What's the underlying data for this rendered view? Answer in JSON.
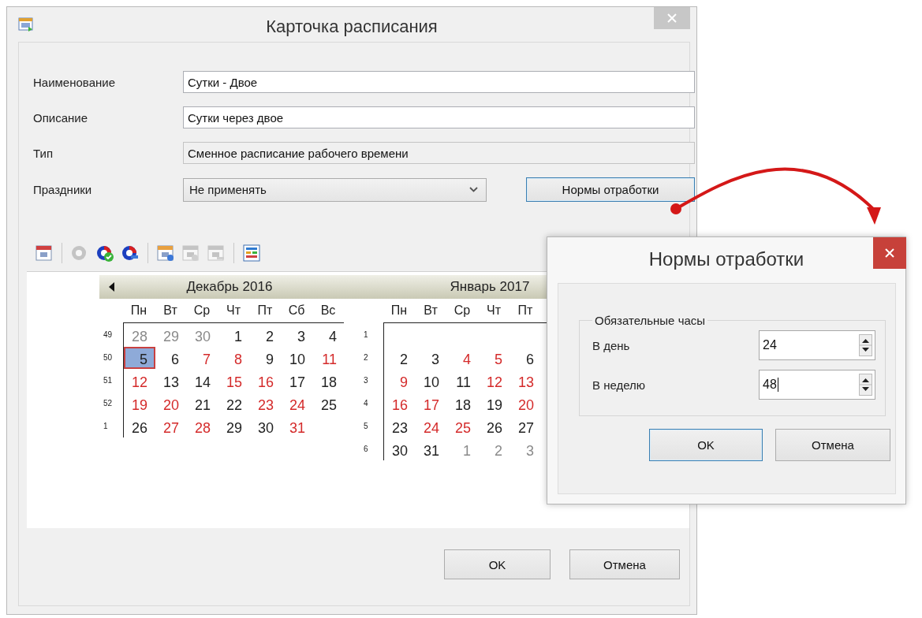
{
  "main_dialog": {
    "title": "Карточка расписания",
    "fields": [
      {
        "label": "Наименование",
        "value": "Сутки - Двое",
        "readonly": false
      },
      {
        "label": "Описание",
        "value": "Сутки через двое",
        "readonly": false
      },
      {
        "label": "Тип",
        "value": "Сменное расписание рабочего времени",
        "readonly": true
      }
    ],
    "holidays": {
      "label": "Праздники",
      "value": "Не применять"
    },
    "norms_button": {
      "label": "Нормы отработки",
      "default": true
    },
    "toolbar": [
      {
        "kind": "calendar",
        "disabled": false
      },
      {
        "kind": "separator"
      },
      {
        "kind": "refresh",
        "disabled": true
      },
      {
        "kind": "refresh-check",
        "disabled": false
      },
      {
        "kind": "refresh-minus",
        "disabled": false
      },
      {
        "kind": "separator"
      },
      {
        "kind": "day-edit",
        "disabled": false
      },
      {
        "kind": "day-check",
        "disabled": true
      },
      {
        "kind": "day-minus",
        "disabled": true
      },
      {
        "kind": "separator"
      },
      {
        "kind": "grid",
        "disabled": false
      }
    ],
    "calendar": {
      "months": [
        {
          "title": "Декабрь 2016",
          "has_prev": true,
          "weekdays": [
            "Пн",
            "Вт",
            "Ср",
            "Чт",
            "Пт",
            "Сб",
            "Вс"
          ],
          "weeks": [
            {
              "number": "49",
              "days": [
                {
                  "text": "28",
                  "kind": "other",
                  "selected": false
                },
                {
                  "text": "29",
                  "kind": "other",
                  "selected": false
                },
                {
                  "text": "30",
                  "kind": "other",
                  "selected": false
                },
                {
                  "text": "1",
                  "kind": "work",
                  "selected": false
                },
                {
                  "text": "2",
                  "kind": "work",
                  "selected": false
                },
                {
                  "text": "3",
                  "kind": "work",
                  "selected": false
                },
                {
                  "text": "4",
                  "kind": "work",
                  "selected": false
                }
              ]
            },
            {
              "number": "50",
              "days": [
                {
                  "text": "5",
                  "kind": "work",
                  "selected": true
                },
                {
                  "text": "6",
                  "kind": "work",
                  "selected": false
                },
                {
                  "text": "7",
                  "kind": "off",
                  "selected": false
                },
                {
                  "text": "8",
                  "kind": "off",
                  "selected": false
                },
                {
                  "text": "9",
                  "kind": "work",
                  "selected": false
                },
                {
                  "text": "10",
                  "kind": "work",
                  "selected": false
                },
                {
                  "text": "11",
                  "kind": "off",
                  "selected": false
                }
              ]
            },
            {
              "number": "51",
              "days": [
                {
                  "text": "12",
                  "kind": "off",
                  "selected": false
                },
                {
                  "text": "13",
                  "kind": "work",
                  "selected": false
                },
                {
                  "text": "14",
                  "kind": "work",
                  "selected": false
                },
                {
                  "text": "15",
                  "kind": "off",
                  "selected": false
                },
                {
                  "text": "16",
                  "kind": "off",
                  "selected": false
                },
                {
                  "text": "17",
                  "kind": "work",
                  "selected": false
                },
                {
                  "text": "18",
                  "kind": "work",
                  "selected": false
                }
              ]
            },
            {
              "number": "52",
              "days": [
                {
                  "text": "19",
                  "kind": "off",
                  "selected": false
                },
                {
                  "text": "20",
                  "kind": "off",
                  "selected": false
                },
                {
                  "text": "21",
                  "kind": "work",
                  "selected": false
                },
                {
                  "text": "22",
                  "kind": "work",
                  "selected": false
                },
                {
                  "text": "23",
                  "kind": "off",
                  "selected": false
                },
                {
                  "text": "24",
                  "kind": "off",
                  "selected": false
                },
                {
                  "text": "25",
                  "kind": "work",
                  "selected": false
                }
              ]
            },
            {
              "number": "1",
              "days": [
                {
                  "text": "26",
                  "kind": "work",
                  "selected": false
                },
                {
                  "text": "27",
                  "kind": "off",
                  "selected": false
                },
                {
                  "text": "28",
                  "kind": "off",
                  "selected": false
                },
                {
                  "text": "29",
                  "kind": "work",
                  "selected": false
                },
                {
                  "text": "30",
                  "kind": "work",
                  "selected": false
                },
                {
                  "text": "31",
                  "kind": "off",
                  "selected": false
                }
              ]
            }
          ]
        },
        {
          "title": "Январь 2017",
          "has_prev": false,
          "weekdays": [
            "Пн",
            "Вт",
            "Ср",
            "Чт",
            "Пт"
          ],
          "weeks": [
            {
              "number": "1"
            },
            {
              "number": "2",
              "days": [
                {
                  "text": "2",
                  "kind": "work",
                  "selected": false
                },
                {
                  "text": "3",
                  "kind": "work",
                  "selected": false
                },
                {
                  "text": "4",
                  "kind": "off",
                  "selected": false
                },
                {
                  "text": "5",
                  "kind": "off",
                  "selected": false
                },
                {
                  "text": "6",
                  "kind": "work",
                  "selected": false
                }
              ]
            },
            {
              "number": "3",
              "days": [
                {
                  "text": "9",
                  "kind": "off",
                  "selected": false
                },
                {
                  "text": "10",
                  "kind": "work",
                  "selected": false
                },
                {
                  "text": "11",
                  "kind": "work",
                  "selected": false
                },
                {
                  "text": "12",
                  "kind": "off",
                  "selected": false
                },
                {
                  "text": "13",
                  "kind": "off",
                  "selected": false
                }
              ]
            },
            {
              "number": "4",
              "days": [
                {
                  "text": "16",
                  "kind": "off",
                  "selected": false
                },
                {
                  "text": "17",
                  "kind": "off",
                  "selected": false
                },
                {
                  "text": "18",
                  "kind": "work",
                  "selected": false
                },
                {
                  "text": "19",
                  "kind": "work",
                  "selected": false
                },
                {
                  "text": "20",
                  "kind": "off",
                  "selected": false
                }
              ]
            },
            {
              "number": "5",
              "days": [
                {
                  "text": "23",
                  "kind": "work",
                  "selected": false
                },
                {
                  "text": "24",
                  "kind": "off",
                  "selected": false
                },
                {
                  "text": "25",
                  "kind": "off",
                  "selected": false
                },
                {
                  "text": "26",
                  "kind": "work",
                  "selected": false
                },
                {
                  "text": "27",
                  "kind": "work",
                  "selected": false
                }
              ]
            },
            {
              "number": "6",
              "days": [
                {
                  "text": "30",
                  "kind": "work",
                  "selected": false
                },
                {
                  "text": "31",
                  "kind": "work",
                  "selected": false
                },
                {
                  "text": "1",
                  "kind": "other",
                  "selected": false
                },
                {
                  "text": "2",
                  "kind": "other",
                  "selected": false
                },
                {
                  "text": "3",
                  "kind": "other",
                  "selected": false
                }
              ]
            }
          ]
        }
      ]
    },
    "buttons": [
      {
        "label": "OK",
        "default": false
      },
      {
        "label": "Отмена",
        "default": false
      }
    ]
  },
  "norms_dialog": {
    "title": "Нормы отработки",
    "group": {
      "title": "Обязательные часы",
      "rows": [
        {
          "label": "В день",
          "value": "24",
          "focused": false
        },
        {
          "label": "В неделю",
          "value": "48",
          "focused": true
        }
      ]
    },
    "buttons": [
      {
        "label": "OK",
        "default": true
      },
      {
        "label": "Отмена",
        "default": false
      }
    ]
  }
}
